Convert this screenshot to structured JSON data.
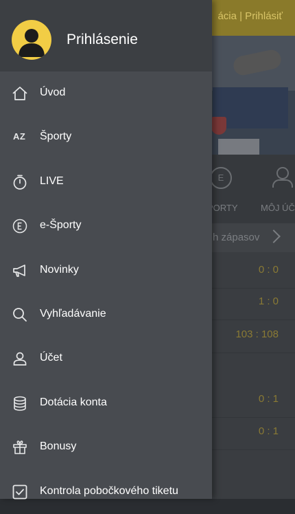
{
  "background": {
    "topbar_text": "ácia | Prihlásiť",
    "nav_labels": [
      "PORTY",
      "MÔJ ÚČ"
    ],
    "nav_icon_letter": "E",
    "filter_text": "h zápasov",
    "scores": [
      "0 : 0",
      "1 : 0",
      "103 : 108",
      "0 : 1",
      "0 : 1"
    ]
  },
  "drawer": {
    "header": {
      "title": "Prihlásenie"
    },
    "menu": [
      {
        "label": "Úvod",
        "icon": "home-icon"
      },
      {
        "label": "Športy",
        "icon": "az-icon",
        "icon_text": "AZ"
      },
      {
        "label": "LIVE",
        "icon": "stopwatch-icon"
      },
      {
        "label": "e-Športy",
        "icon": "esports-icon",
        "icon_text": "E"
      },
      {
        "label": "Novinky",
        "icon": "megaphone-icon"
      },
      {
        "label": "Vyhľadávanie",
        "icon": "search-icon"
      },
      {
        "label": "Účet",
        "icon": "user-icon"
      },
      {
        "label": "Dotácia konta",
        "icon": "coins-icon"
      },
      {
        "label": "Bonusy",
        "icon": "gift-icon"
      },
      {
        "label": "Kontrola pobočkového tiketu",
        "icon": "checkbox-icon"
      }
    ]
  },
  "colors": {
    "drawer_bg": "#484b50",
    "header_bg": "#3c3f43",
    "avatar_bg": "#f2cd45",
    "accent_gold": "#d9c568"
  }
}
